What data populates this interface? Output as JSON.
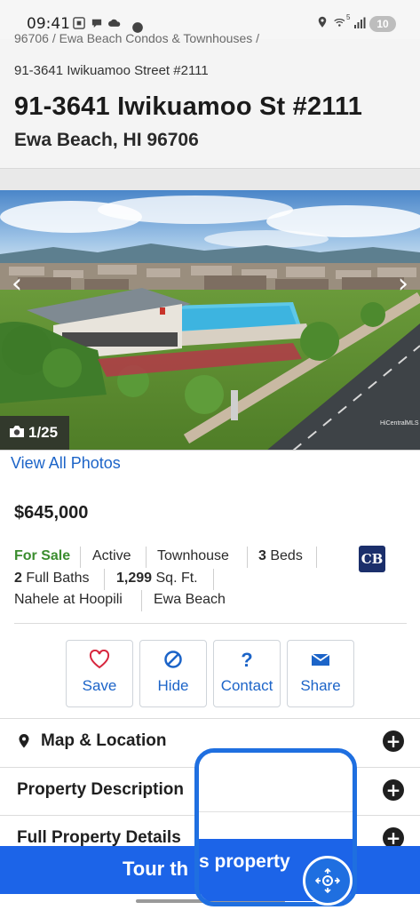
{
  "status_bar": {
    "time": "09:41",
    "battery": "10",
    "signal_label": "5"
  },
  "header": {
    "breadcrumb_top": "96706 / Ewa Beach Condos & Townhouses /",
    "breadcrumb_address": "91-3641 Iwikuamoo Street #2111",
    "title": "91-3641 Iwikuamoo St #2111",
    "subtitle": "Ewa Beach, HI 96706"
  },
  "photo": {
    "counter": "1/25",
    "credit": "HiCentralMLS",
    "view_all": "View All Photos"
  },
  "listing": {
    "price": "$645,000",
    "status": "For Sale",
    "state": "Active",
    "type": "Townhouse",
    "beds_count": "3",
    "beds_label": " Beds",
    "baths_count": "2",
    "baths_label": " Full Baths",
    "sqft_count": "1,299",
    "sqft_label": " Sq. Ft.",
    "community": "Nahele at Hoopili",
    "area": "Ewa Beach",
    "brokerage_logo": "CB"
  },
  "actions": [
    {
      "label": "Save",
      "icon": "heart-icon"
    },
    {
      "label": "Hide",
      "icon": "hide-icon"
    },
    {
      "label": "Contact",
      "icon": "question-icon"
    },
    {
      "label": "Share",
      "icon": "envelope-icon"
    }
  ],
  "sections": [
    {
      "label": "Map & Location",
      "icon": "map-pin-icon"
    },
    {
      "label": "Property Description"
    },
    {
      "label": "Full Property Details"
    }
  ],
  "cta": {
    "label_left": "Tour th",
    "label_right": "s property"
  },
  "colors": {
    "accent": "#1c64c8",
    "cta": "#1c64e8",
    "for_sale": "#3b8d2f",
    "overlay": "#1f6fe0"
  }
}
